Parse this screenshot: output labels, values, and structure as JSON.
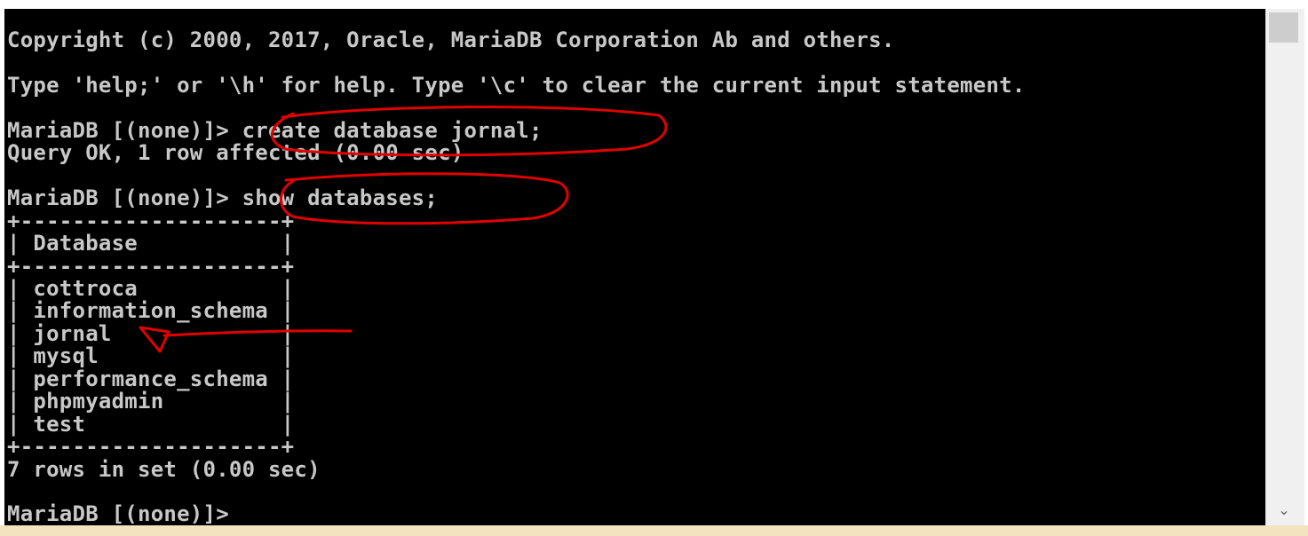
{
  "terminal": {
    "lines": [
      "Copyright (c) 2000, 2017, Oracle, MariaDB Corporation Ab and others.",
      "Type 'help;' or '\\h' for help. Type '\\c' to clear the current input statement.",
      "MariaDB [(none)]> create database jornal;",
      "Query OK, 1 row affected (0.00 sec)",
      "MariaDB [(none)]> show databases;",
      "+--------------------+",
      "| Database           |",
      "+--------------------+",
      "| cottroca           |",
      "| information_schema |",
      "| jornal             |",
      "| mysql              |",
      "| performance_schema |",
      "| phpmyadmin         |",
      "| test               |",
      "+--------------------+",
      "7 rows in set (0.00 sec)",
      "MariaDB [(none)]>"
    ]
  },
  "colors": {
    "terminal_bg": "#000000",
    "terminal_text": "#c8c8c8",
    "annotation": "#e00000",
    "bottom_bar": "#f4e3bf"
  },
  "icons": {
    "scroll_down": "chevron-down-icon"
  },
  "scrollbar": {
    "down_glyph": "⌄"
  }
}
